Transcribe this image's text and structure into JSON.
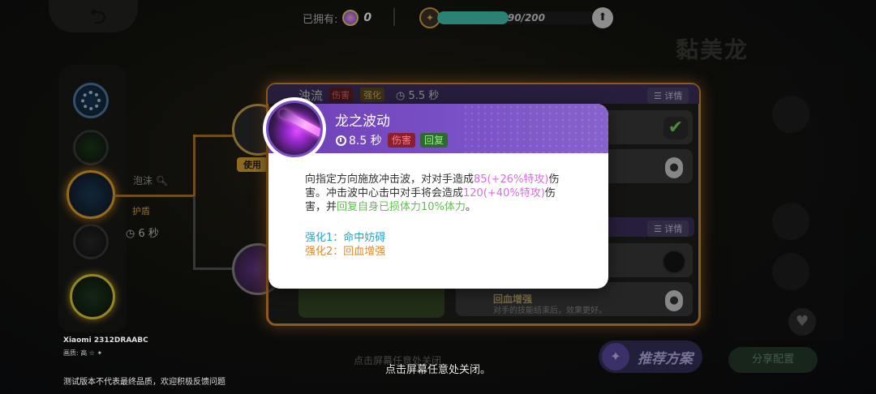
{
  "top": {
    "owned_label": "已拥有:",
    "owned_count": "0",
    "xp_text": "90/200",
    "xp_fraction": 0.45,
    "monster_name": "黏美龙"
  },
  "left": {
    "foam_label": "泡沫",
    "shield_label": "护盾",
    "cooldown": "6 秒",
    "use_label": "使用"
  },
  "panel": {
    "skill_title": "浊流",
    "tag_damage": "伤害",
    "tag_enhance": "强化",
    "cooldown": "5.5 秒",
    "detail_label": "详情",
    "row4_title": "回血增强",
    "row4_sub": "对手的技能结束后，效果更好。"
  },
  "popup": {
    "skill_name": "龙之波动",
    "cooldown": "8.5 秒",
    "tag_damage": "伤害",
    "tag_heal": "回复",
    "desc_part1": "向指定方向施放冲击波，对对手造成",
    "desc_val1": "85(+26%特攻)",
    "desc_part2": "伤害。冲击波中心击中对手将会造成",
    "desc_val2": "120(+40%特攻)",
    "desc_part3": "伤害，并",
    "desc_val3": "回复自身已损体力10%体力",
    "desc_part4": "。",
    "enhance1": "强化1：命中妨碍",
    "enhance2": "强化2：回血增强"
  },
  "bottom": {
    "close_hint": "点击屏幕任意处关闭。",
    "bg_close_hint": "点击屏幕任意处关闭",
    "recommend_label": "推荐方案",
    "share_label": "分享配置",
    "device": "Xiaomi 2312DRAABC",
    "device_sub": "画质: 高 ☆ ✦",
    "disclaimer": "测试版本不代表最终品质，欢迎积极反馈问题"
  },
  "colors": {
    "popup_header": "#7049bb",
    "accent_orange": "#d8892f",
    "damage_tag": "#8a1f2e",
    "heal_tag": "#2d6a2d",
    "enhance1_color": "#2aa6c8",
    "enhance2_color": "#e08a2a"
  },
  "icons": [
    "back-arrow-icon",
    "gem-icon",
    "level-badge-icon",
    "upgrade-arrow-icon",
    "gear-icon",
    "search-icon",
    "clock-icon",
    "check-icon",
    "lock-icon",
    "heart-icon",
    "bulb-icon"
  ]
}
